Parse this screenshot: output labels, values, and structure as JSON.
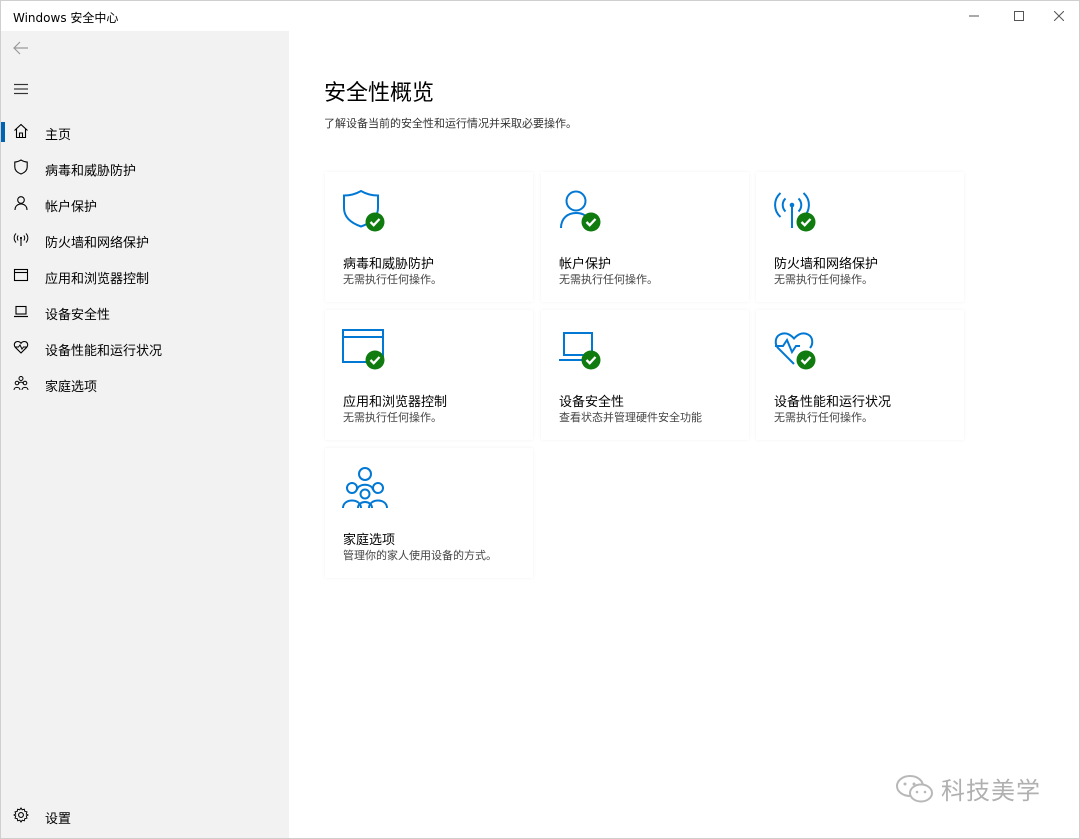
{
  "window": {
    "title": "Windows 安全中心",
    "controls": {
      "minimize": "—",
      "maximize": "☐",
      "close": "✕"
    }
  },
  "sidebar": {
    "back_icon": "back-arrow-icon",
    "menu_icon": "hamburger-menu-icon",
    "items": [
      {
        "label": "主页",
        "icon": "home-icon",
        "active": true
      },
      {
        "label": "病毒和威胁防护",
        "icon": "shield-icon"
      },
      {
        "label": "帐户保护",
        "icon": "person-icon"
      },
      {
        "label": "防火墙和网络保护",
        "icon": "antenna-icon"
      },
      {
        "label": "应用和浏览器控制",
        "icon": "browser-window-icon"
      },
      {
        "label": "设备安全性",
        "icon": "laptop-icon"
      },
      {
        "label": "设备性能和运行状况",
        "icon": "heart-icon"
      },
      {
        "label": "家庭选项",
        "icon": "family-icon"
      }
    ],
    "settings": {
      "label": "设置",
      "icon": "gear-icon"
    }
  },
  "main": {
    "title": "安全性概览",
    "subtitle": "了解设备当前的安全性和运行情况并采取必要操作。",
    "cards": [
      {
        "title": "病毒和威胁防护",
        "desc": "无需执行任何操作。",
        "icon": "shield-icon",
        "status": "ok"
      },
      {
        "title": "帐户保护",
        "desc": "无需执行任何操作。",
        "icon": "person-icon",
        "status": "ok"
      },
      {
        "title": "防火墙和网络保护",
        "desc": "无需执行任何操作。",
        "icon": "antenna-icon",
        "status": "ok"
      },
      {
        "title": "应用和浏览器控制",
        "desc": "无需执行任何操作。",
        "icon": "browser-window-icon",
        "status": "ok"
      },
      {
        "title": "设备安全性",
        "desc": "查看状态并管理硬件安全功能",
        "icon": "laptop-icon",
        "status": "ok"
      },
      {
        "title": "设备性能和运行状况",
        "desc": "无需执行任何操作。",
        "icon": "heart-icon",
        "status": "ok"
      },
      {
        "title": "家庭选项",
        "desc": "管理你的家人使用设备的方式。",
        "icon": "family-icon"
      }
    ]
  },
  "watermark": {
    "text": "科技美学",
    "icon": "wechat-icon"
  },
  "colors": {
    "accent": "#0063b1",
    "icon_blue": "#0078d4",
    "check_green": "#107c10",
    "sidebar_bg": "#f2f2f2"
  }
}
